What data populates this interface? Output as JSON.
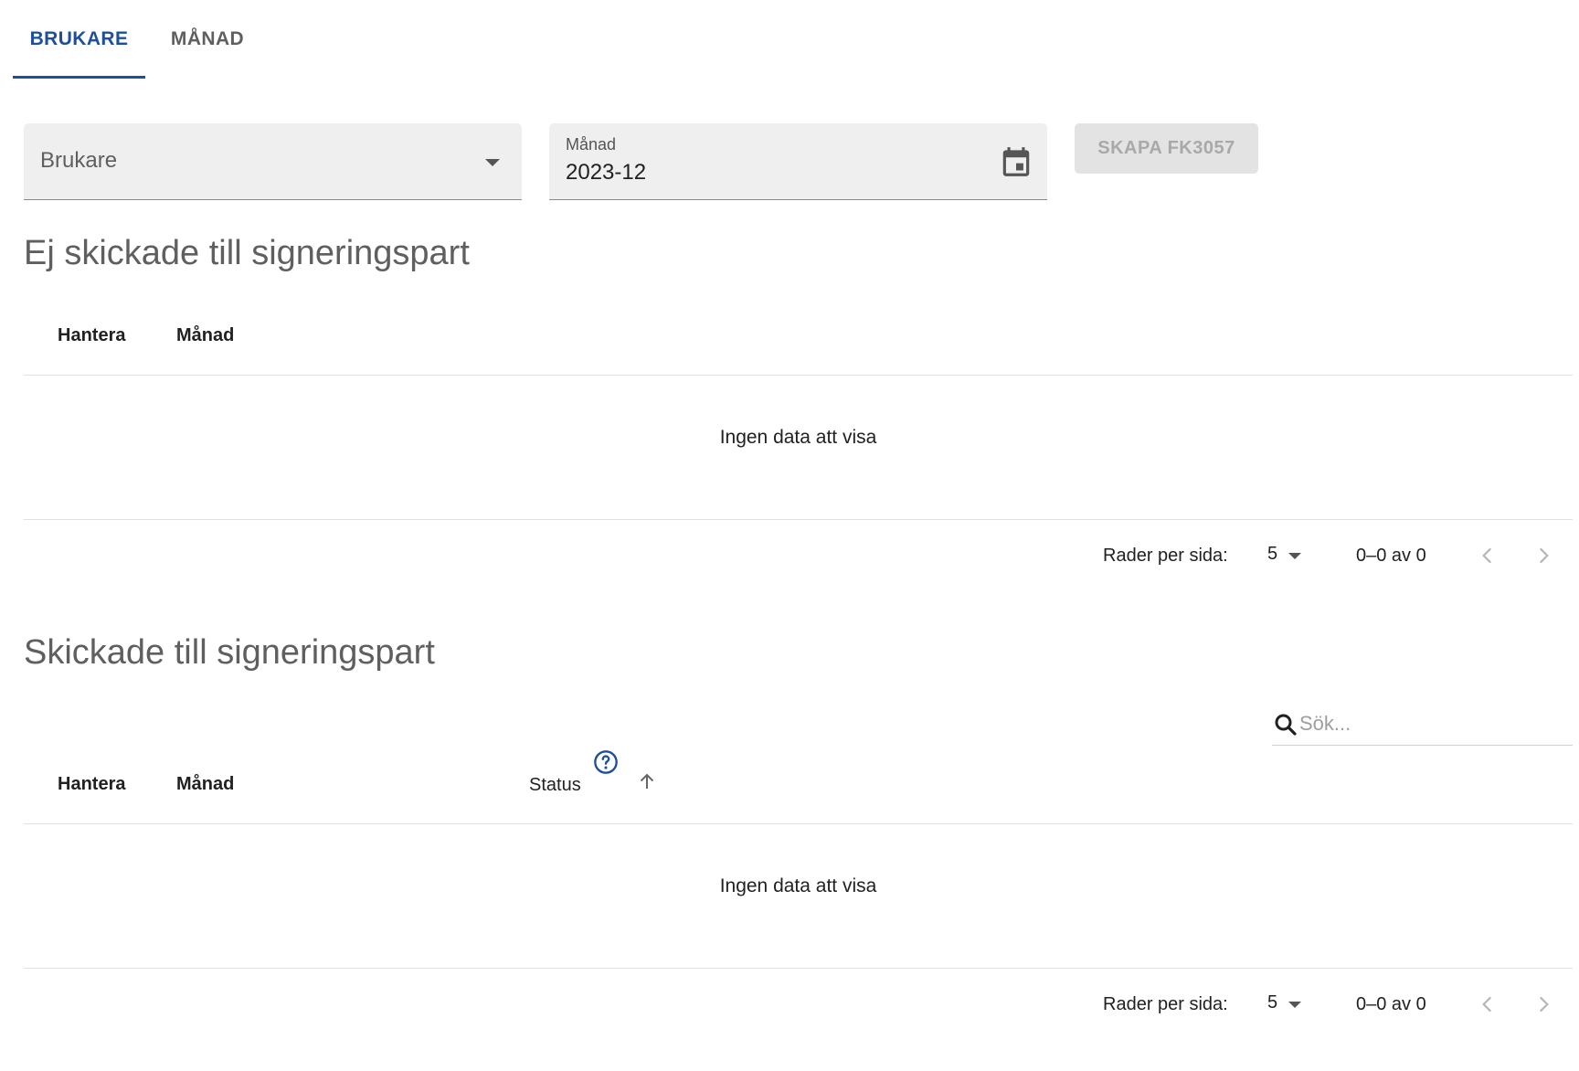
{
  "tabs": [
    {
      "label": "BRUKARE",
      "active": true
    },
    {
      "label": "MÅNAD",
      "active": false
    }
  ],
  "filters": {
    "users_select": {
      "value": "Brukare"
    },
    "month_field": {
      "label": "Månad",
      "value": "2023-12"
    },
    "create_button": {
      "label": "SKAPA FK3057",
      "disabled": true
    }
  },
  "not_sent": {
    "title": "Ej skickade till signeringspart",
    "columns": [
      "Hantera",
      "Månad"
    ],
    "empty_text": "Ingen data att visa",
    "pagination": {
      "rows_label": "Rader per sida:",
      "rows_value": "5",
      "range": "0–0 av 0"
    }
  },
  "sent": {
    "title": "Skickade till signeringspart",
    "search_placeholder": "Sök...",
    "columns": [
      "Hantera",
      "Månad",
      "Status"
    ],
    "empty_text": "Ingen data att visa",
    "pagination": {
      "rows_label": "Rader per sida:",
      "rows_value": "5",
      "range": "0–0 av 0"
    }
  },
  "colors": {
    "accent": "#1d4f9c",
    "field_bg": "#efefef",
    "button_disabled_bg": "#e3e3e3",
    "button_disabled_text": "#a9a9a9",
    "divider": "#e0e0e0"
  },
  "icons": {
    "users_select": "caret-down-icon",
    "month_field": "calendar-icon",
    "search": "search-icon",
    "status_help": "help-circle-icon",
    "status_sort": "arrow-up-icon",
    "rows_select": "caret-down-icon",
    "prev_page": "chevron-left-icon",
    "next_page": "chevron-right-icon"
  }
}
